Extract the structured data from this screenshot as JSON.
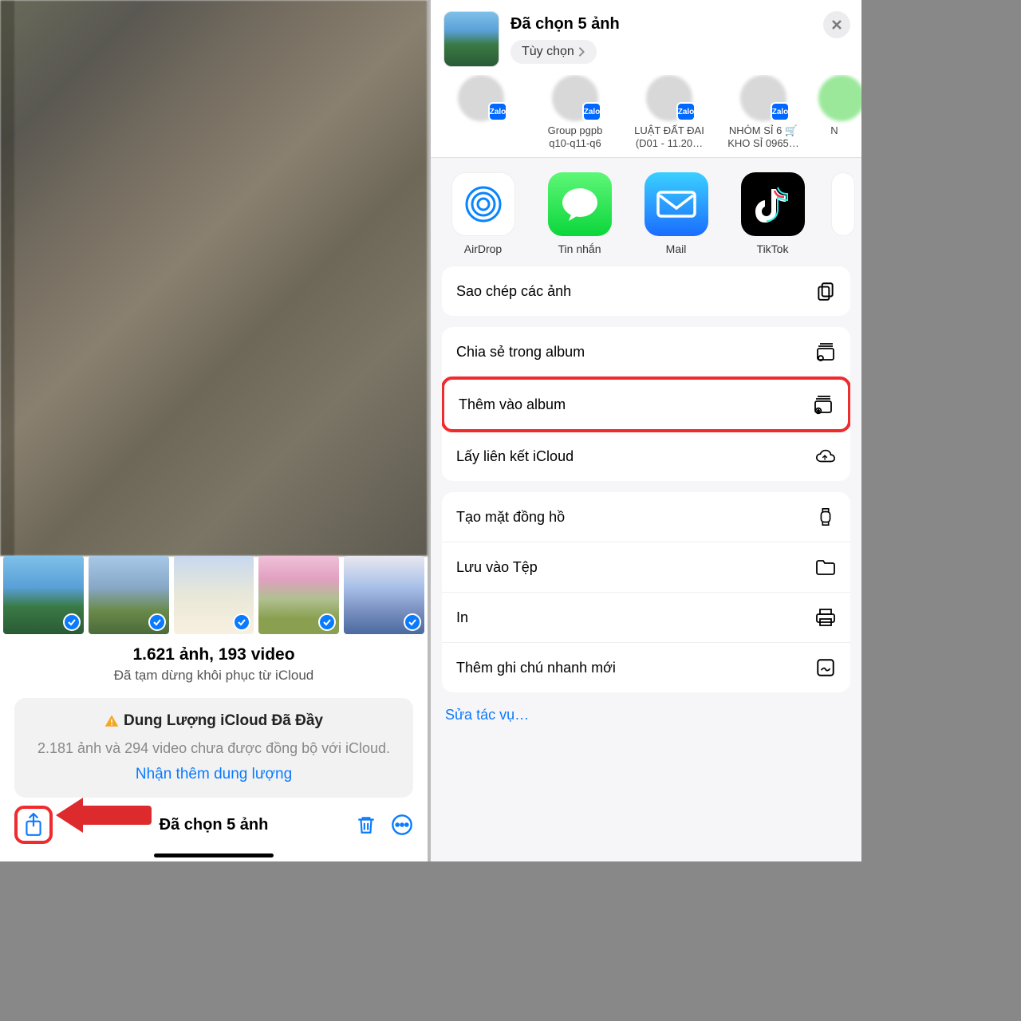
{
  "left": {
    "stats": {
      "title": "1.621 ảnh, 193 video",
      "subtitle": "Đã tạm dừng khôi phục từ iCloud"
    },
    "icloud_card": {
      "title": "Dung Lượng iCloud Đã Đầy",
      "body": "2.181 ảnh và 294 video chưa được đồng bộ với iCloud.",
      "link": "Nhận thêm dung lượng"
    },
    "toolbar": {
      "selection_label": "Đã chọn 5 ảnh"
    }
  },
  "right": {
    "header": {
      "title": "Đã chọn 5 ảnh",
      "options": "Tùy chọn"
    },
    "contacts": [
      {
        "line1": "",
        "line2": ""
      },
      {
        "line1": "Group pgpb",
        "line2": "q10-q11-q6"
      },
      {
        "line1": "LUẬT ĐẤT ĐAI",
        "line2": "(D01 - 11.20…"
      },
      {
        "line1": "NHÓM SỈ 6 🛒",
        "line2": "KHO SỈ 0965…"
      }
    ],
    "apps": [
      {
        "id": "airdrop",
        "label": "AirDrop"
      },
      {
        "id": "messages",
        "label": "Tin nhắn"
      },
      {
        "id": "mail",
        "label": "Mail"
      },
      {
        "id": "tiktok",
        "label": "TikTok"
      }
    ],
    "actions_group1": [
      {
        "label": "Sao chép các ảnh",
        "icon": "copy"
      }
    ],
    "actions_group2": [
      {
        "label": "Chia sẻ trong album",
        "icon": "album-share"
      },
      {
        "label": "Thêm vào album",
        "icon": "album-add",
        "highlight": true
      },
      {
        "label": "Lấy liên kết iCloud",
        "icon": "icloud-link"
      }
    ],
    "actions_group3": [
      {
        "label": "Tạo mặt đồng hồ",
        "icon": "watch"
      },
      {
        "label": "Lưu vào Tệp",
        "icon": "folder"
      },
      {
        "label": "In",
        "icon": "printer"
      },
      {
        "label": "Thêm ghi chú nhanh mới",
        "icon": "quicknote"
      }
    ],
    "edit_link": "Sửa tác vụ…"
  }
}
